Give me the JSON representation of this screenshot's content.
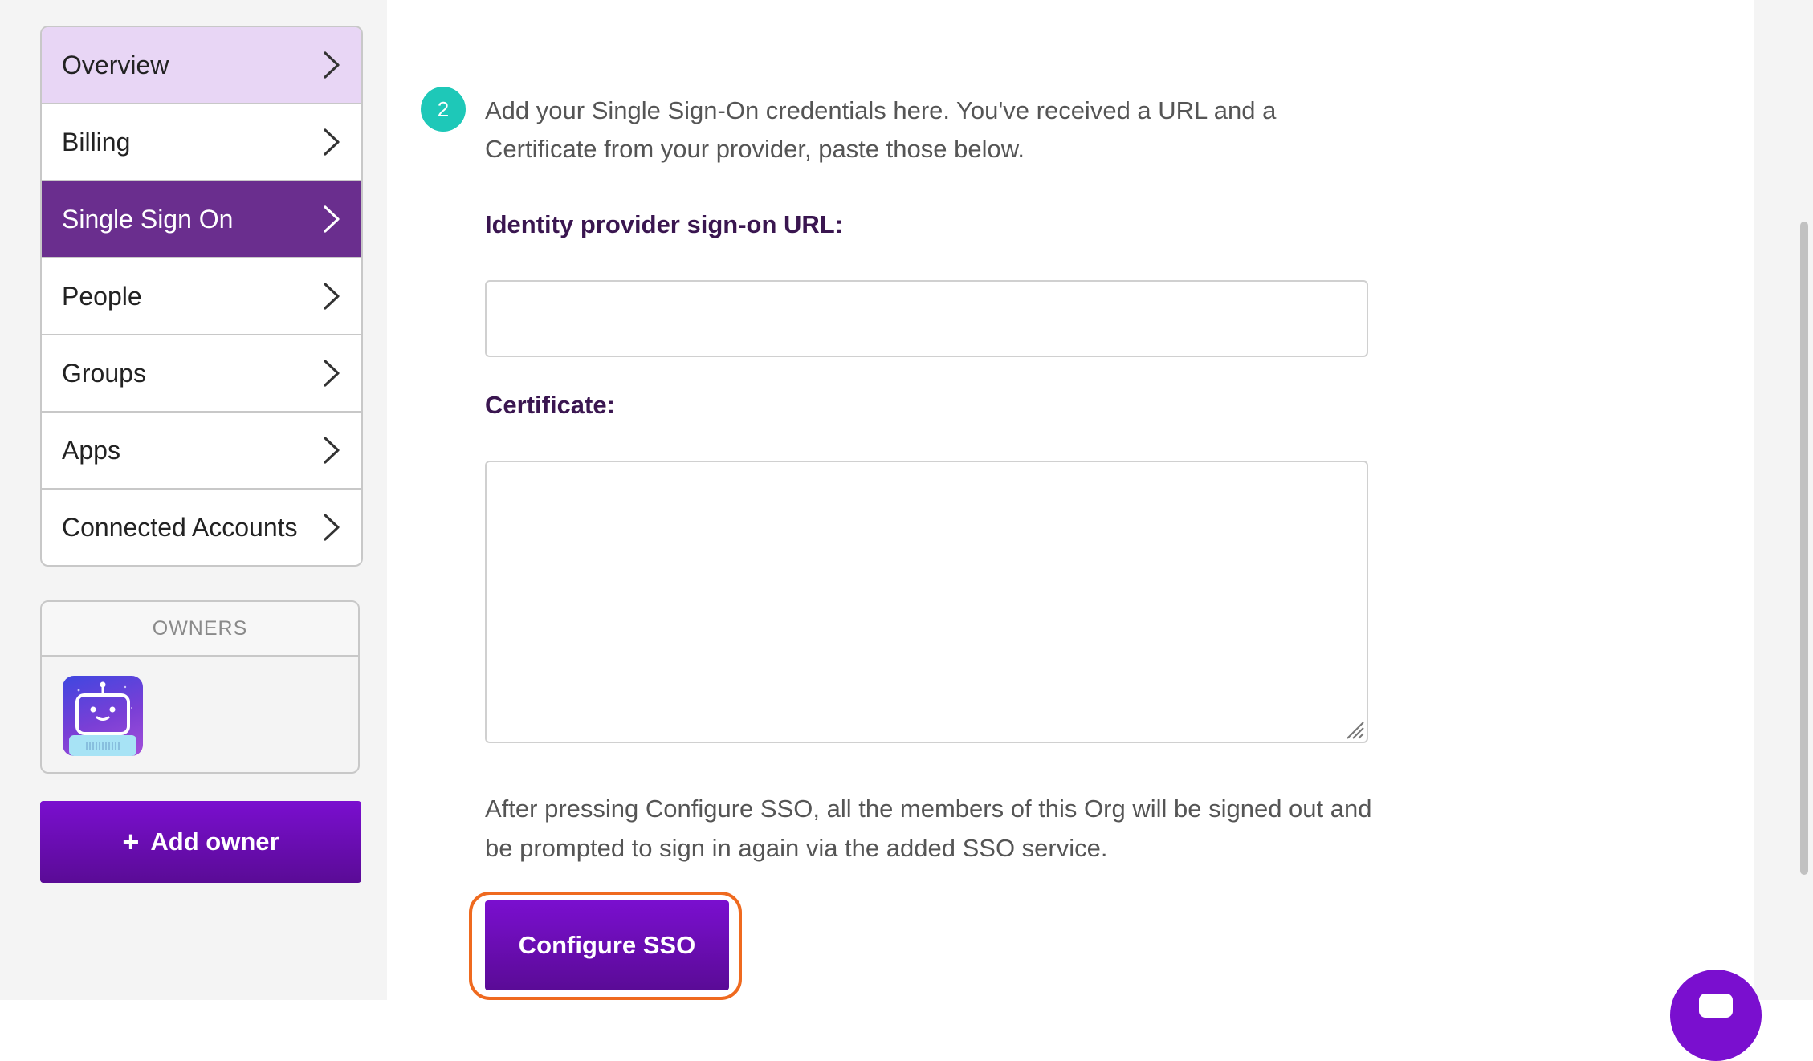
{
  "sidebar": {
    "items": [
      {
        "label": "Overview",
        "state": "hover"
      },
      {
        "label": "Billing",
        "state": "default"
      },
      {
        "label": "Single Sign On",
        "state": "active"
      },
      {
        "label": "People",
        "state": "default"
      },
      {
        "label": "Groups",
        "state": "default"
      },
      {
        "label": "Apps",
        "state": "default"
      },
      {
        "label": "Connected Accounts",
        "state": "default"
      }
    ],
    "owners_heading": "OWNERS",
    "add_owner_label": "Add owner"
  },
  "main": {
    "step_number": "2",
    "intro_text": "Add your Single Sign-On credentials here. You've received a URL and a Certificate from your provider, paste those below.",
    "url_label": "Identity provider sign-on URL:",
    "url_value": "",
    "certificate_label": "Certificate:",
    "certificate_value": "",
    "note_text": "After pressing Configure SSO, all the members of this Org will be signed out and be prompted to sign in again via the added SSO service.",
    "configure_button_label": "Configure SSO"
  },
  "colors": {
    "accent_purple": "#7a0fcf",
    "active_nav": "#6a2e8e",
    "hover_nav": "#e8d6f5",
    "step_badge": "#1ec8b8",
    "highlight_outline": "#ef6a1f"
  },
  "icons": {
    "chevron": "chevron-right-icon",
    "plus": "plus-icon",
    "avatar": "robot-avatar",
    "chat": "chat-icon"
  }
}
